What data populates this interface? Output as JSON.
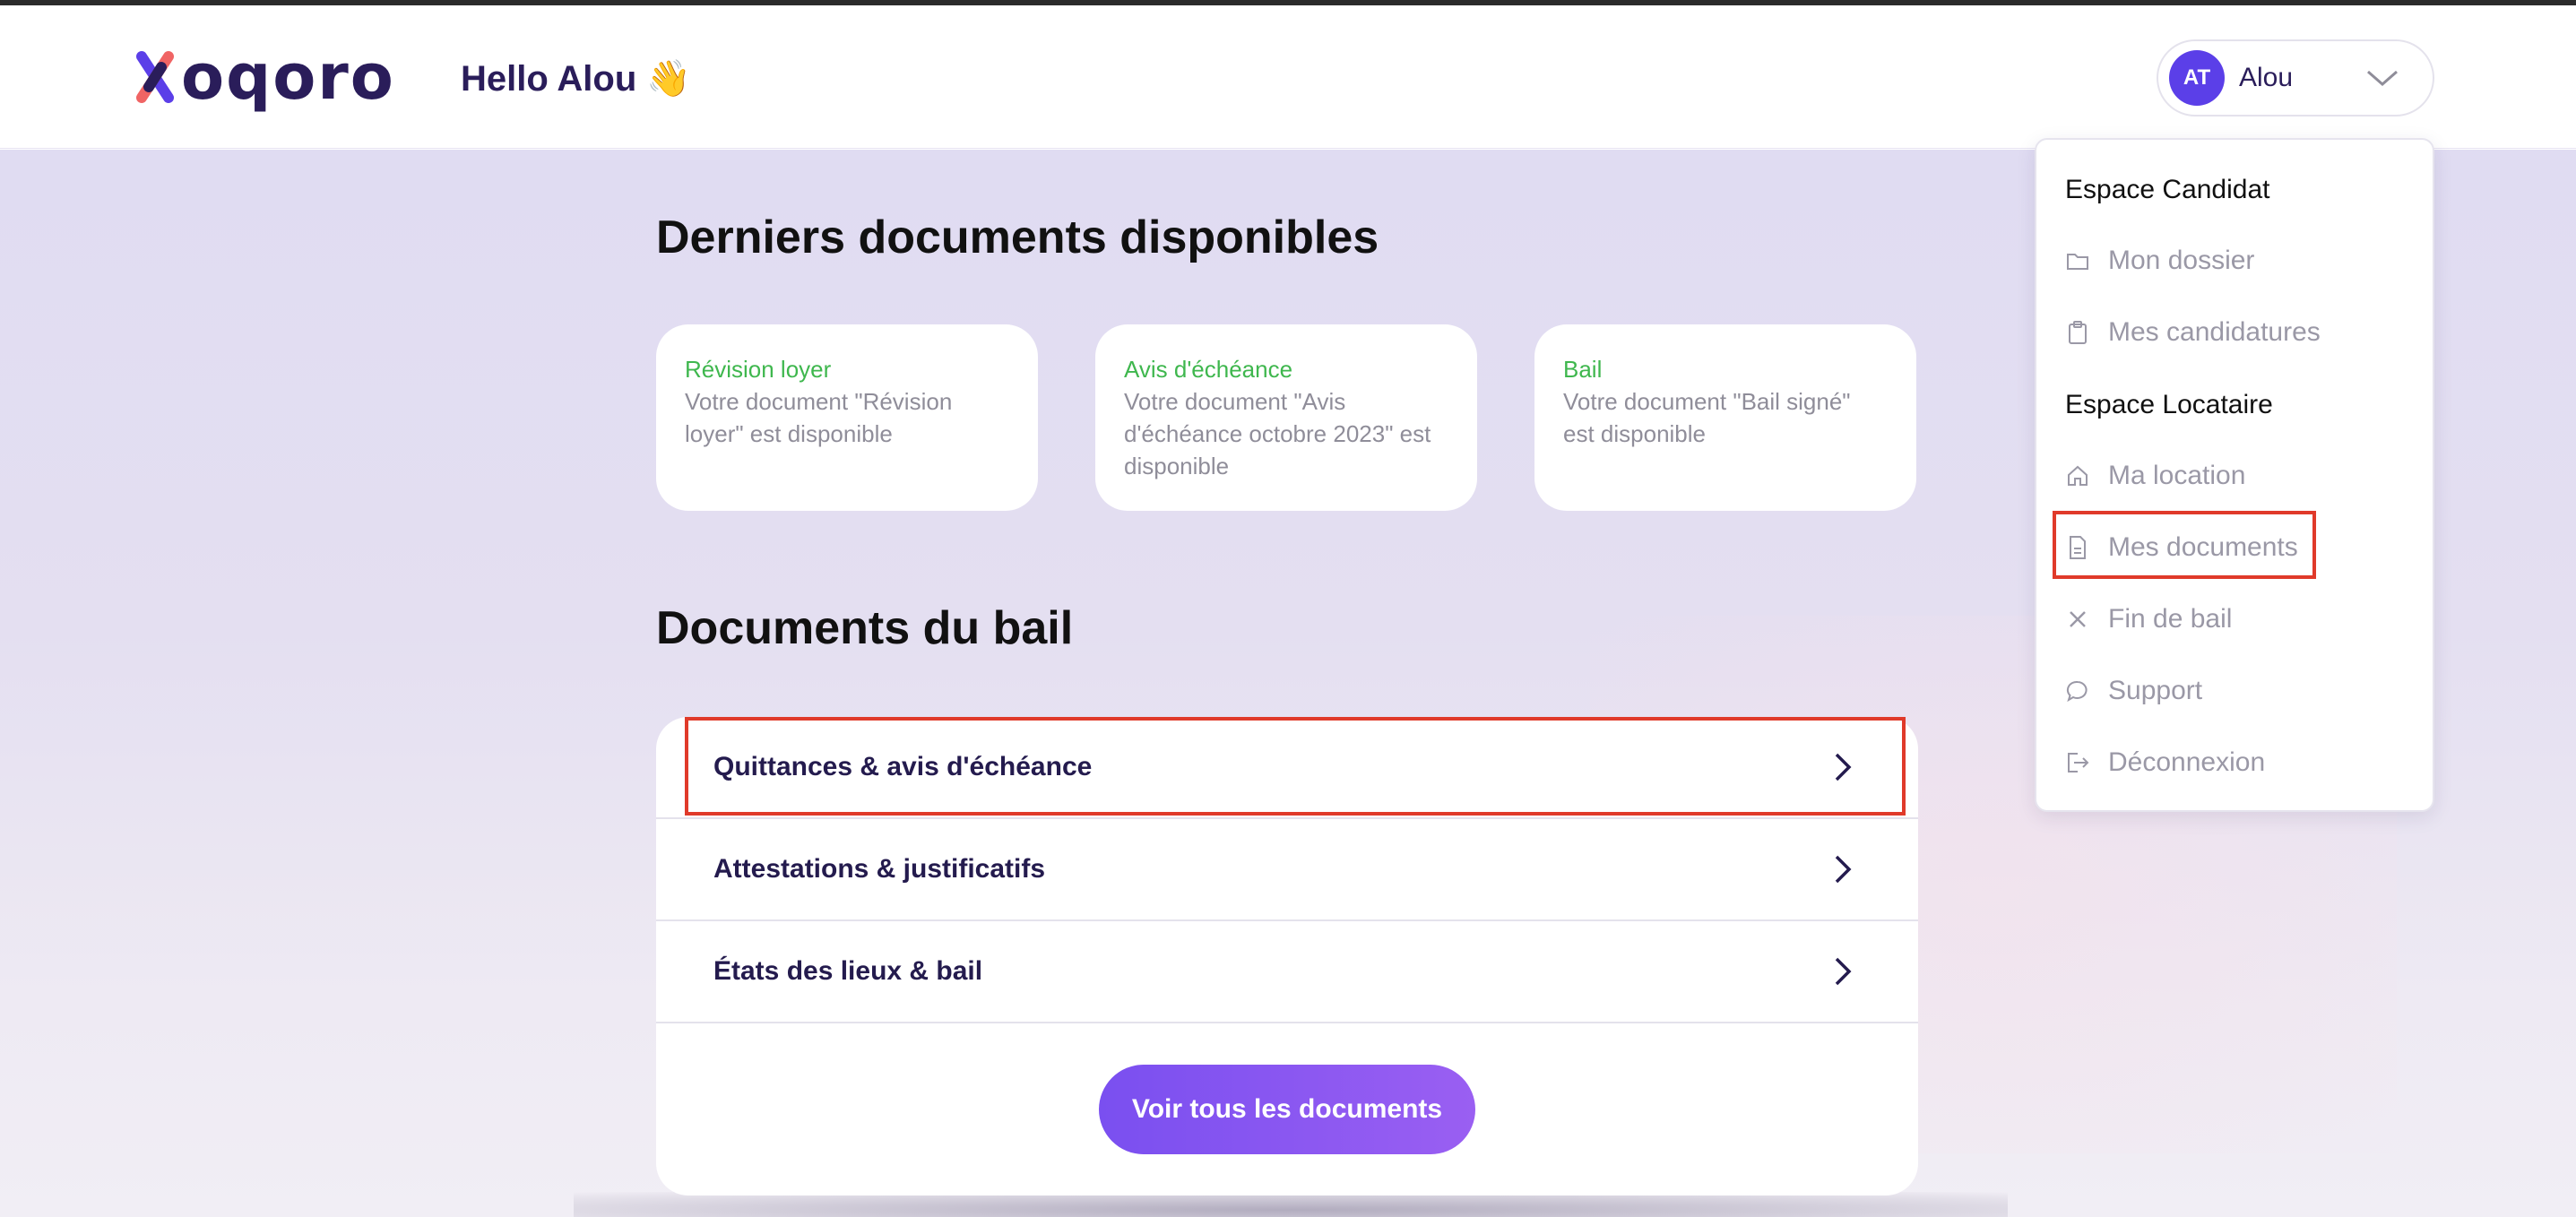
{
  "header": {
    "logo_text": "oqoro",
    "greeting": "Hello Alou",
    "greeting_emoji": "👋",
    "user": {
      "initials": "AT",
      "name": "Alou"
    }
  },
  "latest_documents": {
    "title": "Derniers documents disponibles",
    "cards": [
      {
        "title": "Révision loyer",
        "description": "Votre document \"Révision loyer\" est disponible"
      },
      {
        "title": "Avis d'échéance",
        "description": "Votre document \"Avis d'échéance octobre 2023\" est disponible"
      },
      {
        "title": "Bail",
        "description": "Votre document \"Bail signé\" est disponible"
      }
    ]
  },
  "lease_documents": {
    "title": "Documents du bail",
    "rows": [
      {
        "label": "Quittances & avis d'échéance"
      },
      {
        "label": "Attestations & justificatifs"
      },
      {
        "label": "États des lieux & bail"
      }
    ],
    "cta_label": "Voir tous les documents"
  },
  "menu": {
    "section_candidate": "Espace Candidat",
    "candidate_items": [
      {
        "label": "Mon dossier",
        "icon": "folder-icon"
      },
      {
        "label": "Mes candidatures",
        "icon": "clipboard-icon"
      }
    ],
    "section_tenant": "Espace Locataire",
    "tenant_items": [
      {
        "label": "Ma location",
        "icon": "home-icon"
      },
      {
        "label": "Mes documents",
        "icon": "document-icon"
      },
      {
        "label": "Fin de bail",
        "icon": "close-icon"
      },
      {
        "label": "Support",
        "icon": "chat-bubble-icon"
      },
      {
        "label": "Déconnexion",
        "icon": "logout-icon"
      }
    ]
  },
  "colors": {
    "brand_dark": "#2a1d5a",
    "accent_purple": "#5b3fe8",
    "card_title_green": "#3fb74e",
    "highlight_red": "#e03a2a",
    "page_background": "#e0dcf2"
  }
}
